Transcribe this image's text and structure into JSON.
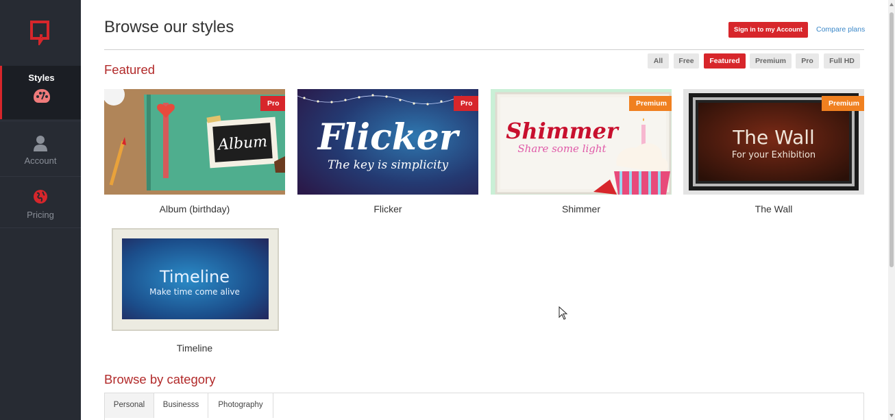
{
  "sidebar": {
    "logo_icon": "brand-logo-icon",
    "items": [
      {
        "label": "Styles",
        "icon": "palette-icon",
        "active": true
      },
      {
        "label": "Account",
        "icon": "user-icon",
        "active": false
      },
      {
        "label": "Pricing",
        "icon": "globe-icon",
        "active": false
      }
    ]
  },
  "header": {
    "title": "Browse our styles",
    "signin_label": "Sign in to my Account",
    "compare_label": "Compare plans"
  },
  "featured": {
    "title": "Featured",
    "filters": [
      "All",
      "Free",
      "Featured",
      "Premium",
      "Pro",
      "Full HD"
    ],
    "active_filter": "Featured",
    "cards": [
      {
        "title": "Album (birthday)",
        "badge": "Pro",
        "thumb_text": "Album"
      },
      {
        "title": "Flicker",
        "badge": "Pro",
        "thumb_text": "Flicker",
        "thumb_subtext": "The key is simplicity"
      },
      {
        "title": "Shimmer",
        "badge": "Premium",
        "thumb_text": "Shimmer",
        "thumb_subtext": "Share some light"
      },
      {
        "title": "The Wall",
        "badge": "Premium",
        "thumb_text": "The Wall",
        "thumb_subtext": "For your Exhibition"
      },
      {
        "title": "Timeline",
        "badge": "",
        "thumb_text": "Timeline",
        "thumb_subtext": "Make time come alive"
      }
    ]
  },
  "category": {
    "title": "Browse by category",
    "tabs": [
      "Personal",
      "Businesss",
      "Photography"
    ],
    "active_tab": "Personal"
  },
  "colors": {
    "sidebar_bg": "#272b33",
    "accent_red": "#d7262b",
    "premium_orange": "#f08020",
    "section_title": "#b22a2a",
    "link_blue": "#3a87c8"
  }
}
